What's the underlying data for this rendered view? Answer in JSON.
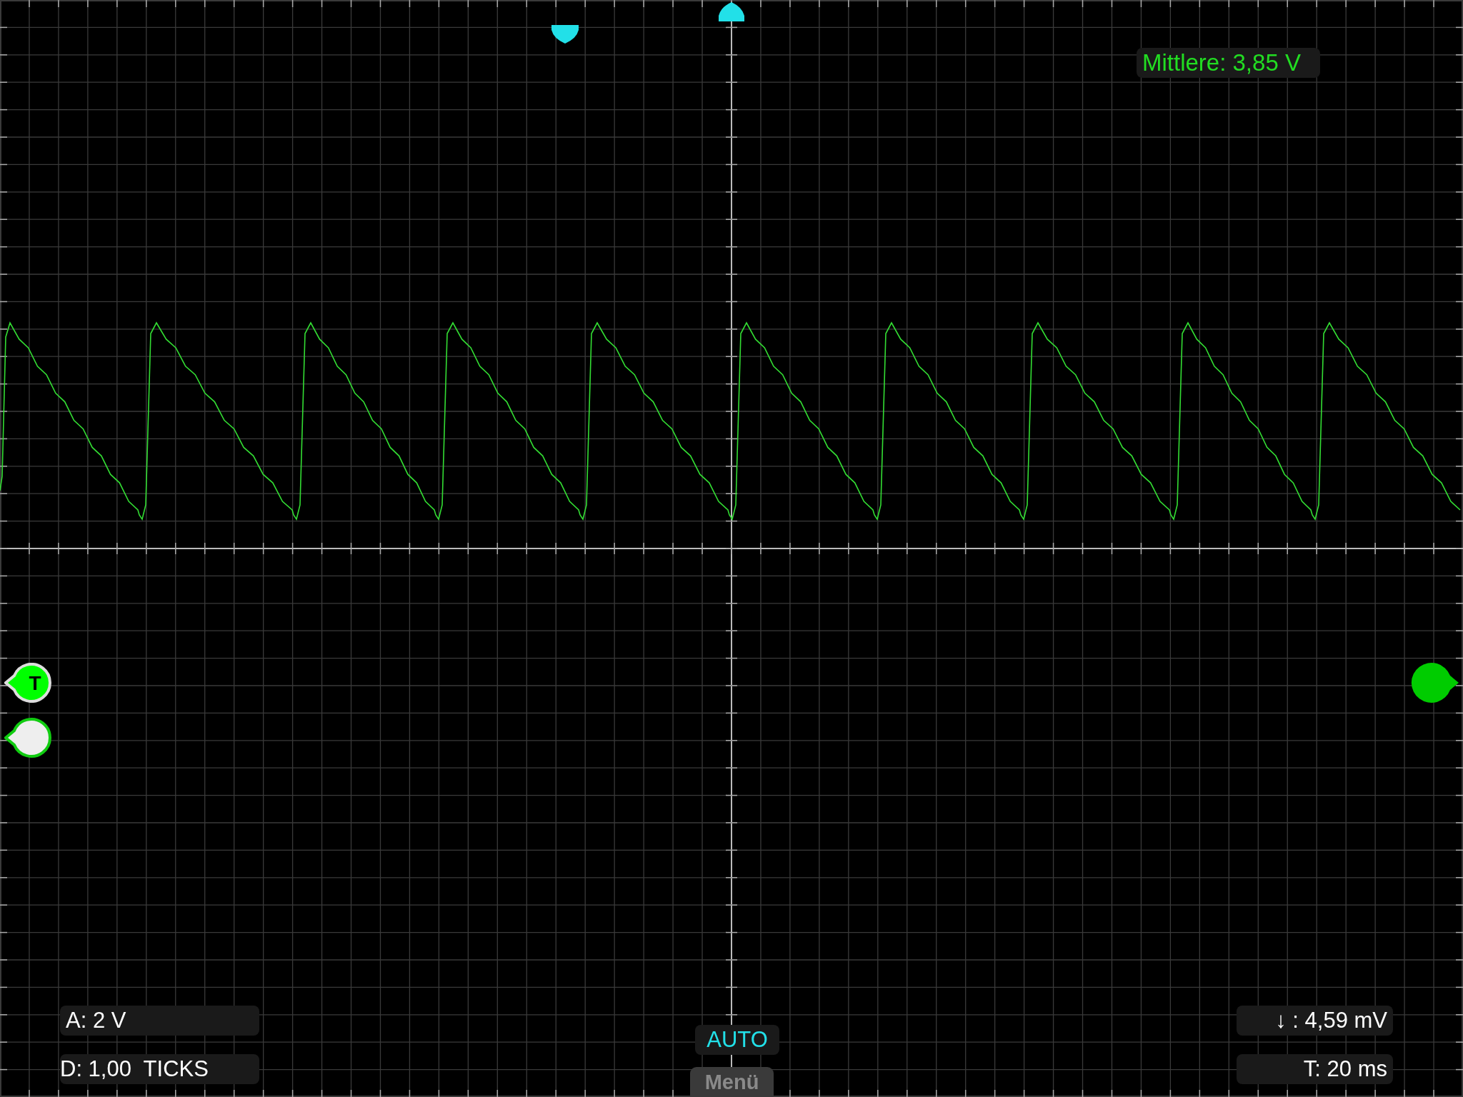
{
  "measurement": {
    "label": "Mittlere: 3,85 V"
  },
  "trigger_marker": {
    "label": "T"
  },
  "channel_scale": {
    "label": "A: 2 V"
  },
  "digital_scale": {
    "label": "D: 1,00  TICKS"
  },
  "cursor_delta": {
    "label": "↓ : 4,59 mV"
  },
  "time_base": {
    "label": "T: 20 ms"
  },
  "trigger_mode": {
    "label": "AUTO"
  },
  "menu_button": {
    "label": "Menü"
  }
}
